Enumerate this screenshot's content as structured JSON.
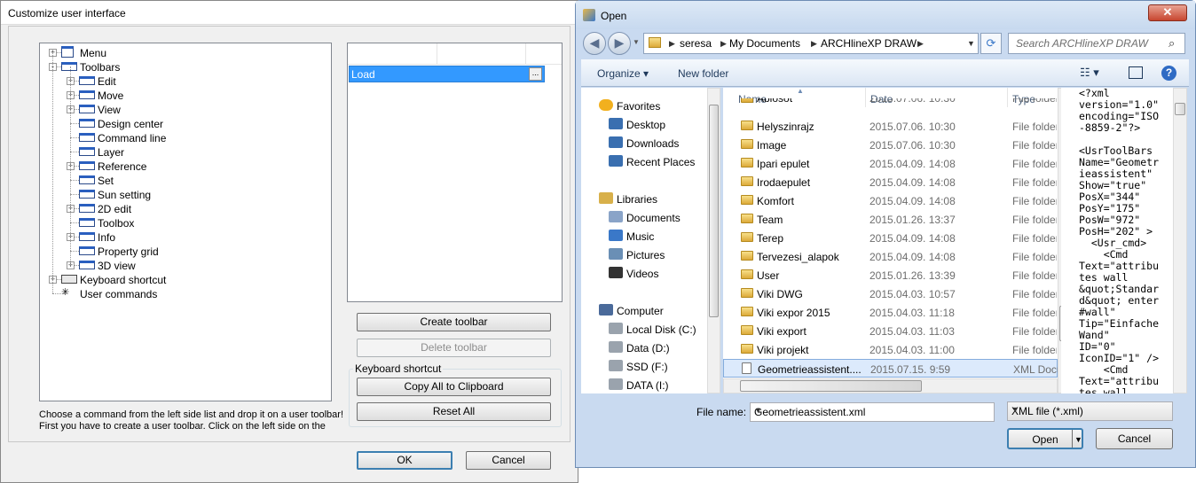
{
  "customize": {
    "title": "Customize user interface",
    "tree": [
      {
        "label": "Menu",
        "level": 0,
        "expander": "+"
      },
      {
        "label": "Toolbars",
        "level": 0,
        "expander": "-"
      },
      {
        "label": "Edit",
        "level": 1,
        "expander": "+"
      },
      {
        "label": "Move",
        "level": 1,
        "expander": "+"
      },
      {
        "label": "View",
        "level": 1,
        "expander": "+"
      },
      {
        "label": "Design center",
        "level": 1,
        "expander": ""
      },
      {
        "label": "Command line",
        "level": 1,
        "expander": ""
      },
      {
        "label": "Layer",
        "level": 1,
        "expander": ""
      },
      {
        "label": "Reference",
        "level": 1,
        "expander": "+"
      },
      {
        "label": "Set",
        "level": 1,
        "expander": ""
      },
      {
        "label": "Sun setting",
        "level": 1,
        "expander": ""
      },
      {
        "label": "2D edit",
        "level": 1,
        "expander": "+"
      },
      {
        "label": "Toolbox",
        "level": 1,
        "expander": ""
      },
      {
        "label": "Info",
        "level": 1,
        "expander": "+"
      },
      {
        "label": "Property grid",
        "level": 1,
        "expander": ""
      },
      {
        "label": "3D view",
        "level": 1,
        "expander": "+"
      },
      {
        "label": "Keyboard shortcut",
        "level": 0,
        "expander": "+"
      },
      {
        "label": "User commands",
        "level": 0,
        "expander": ""
      }
    ],
    "grid_row": "Load",
    "grid_row_button": "...",
    "create_toolbar": "Create toolbar",
    "delete_toolbar": "Delete toolbar",
    "keyboard_group": "Keyboard shortcut",
    "copy_clipboard": "Copy All to Clipboard",
    "reset_all": "Reset All",
    "hint_line1": "Choose a command from the left side list and drop it on a user toolbar!",
    "hint_line2": "First you have to create a user toolbar. Click on the left side on the",
    "ok": "OK",
    "cancel": "Cancel"
  },
  "open": {
    "title": "Open",
    "close": "✕",
    "back_icon": "back-arrow-icon",
    "breadcrumb": [
      "seresa",
      "My Documents",
      "ARCHlineXP DRAW"
    ],
    "search_placeholder": "Search ARCHlineXP DRAW",
    "organize": "Organize",
    "new_folder": "New folder",
    "nav": {
      "favorites": "Favorites",
      "fav_items": [
        "Desktop",
        "Downloads",
        "Recent Places"
      ],
      "libraries": "Libraries",
      "lib_items": [
        "Documents",
        "Music",
        "Pictures",
        "Videos"
      ],
      "computer": "Computer",
      "comp_items": [
        "Local Disk (C:)",
        "Data (D:)",
        "SSD (F:)",
        "DATA (I:)"
      ]
    },
    "columns": {
      "name": "Name",
      "date": "Date",
      "type": "Type"
    },
    "partial_row": {
      "name": "Ablosot",
      "date": "2015.07.06. 10:30",
      "type": "File folder"
    },
    "files": [
      {
        "name": "Helyszinrajz",
        "date": "2015.07.06. 10:30",
        "type": "File folder"
      },
      {
        "name": "Image",
        "date": "2015.07.06. 10:30",
        "type": "File folder"
      },
      {
        "name": "Ipari epulet",
        "date": "2015.04.09. 14:08",
        "type": "File folder"
      },
      {
        "name": "Irodaepulet",
        "date": "2015.04.09. 14:08",
        "type": "File folder"
      },
      {
        "name": "Komfort",
        "date": "2015.04.09. 14:08",
        "type": "File folder"
      },
      {
        "name": "Team",
        "date": "2015.01.26. 13:37",
        "type": "File folder"
      },
      {
        "name": "Terep",
        "date": "2015.04.09. 14:08",
        "type": "File folder"
      },
      {
        "name": "Tervezesi_alapok",
        "date": "2015.04.09. 14:08",
        "type": "File folder"
      },
      {
        "name": "User",
        "date": "2015.01.26. 13:39",
        "type": "File folder"
      },
      {
        "name": "Viki DWG",
        "date": "2015.04.03. 10:57",
        "type": "File folder"
      },
      {
        "name": "Viki expor 2015",
        "date": "2015.04.03. 11:18",
        "type": "File folder"
      },
      {
        "name": "Viki export",
        "date": "2015.04.03. 11:03",
        "type": "File folder"
      },
      {
        "name": "Viki projekt",
        "date": "2015.04.03. 11:00",
        "type": "File folder"
      },
      {
        "name": "Geometrieassistent....",
        "date": "2015.07.15. 9:59",
        "type": "XML Document",
        "selected": true
      }
    ],
    "preview": "<?xml\nversion=\"1.0\"\nencoding=\"ISO\n-8859-2\"?>\n\n<UsrToolBars\nName=\"Geometr\nieassistent\"\nShow=\"true\"\nPosX=\"344\"\nPosY=\"175\"\nPosW=\"972\"\nPosH=\"202\" >\n  <Usr_cmd>\n    <Cmd\nText=\"attribu\ntes wall\n&quot;Standar\nd&quot; enter\n#wall\"\nTip=\"Einfache\nWand\"\nID=\"0\"\nIconID=\"1\" />\n    <Cmd\nText=\"attribu\ntes wall",
    "file_name_label": "File name:",
    "file_name_value": "Geometrieassistent.xml",
    "file_type": "XML file (*.xml)",
    "open_button": "Open",
    "cancel_button": "Cancel"
  }
}
